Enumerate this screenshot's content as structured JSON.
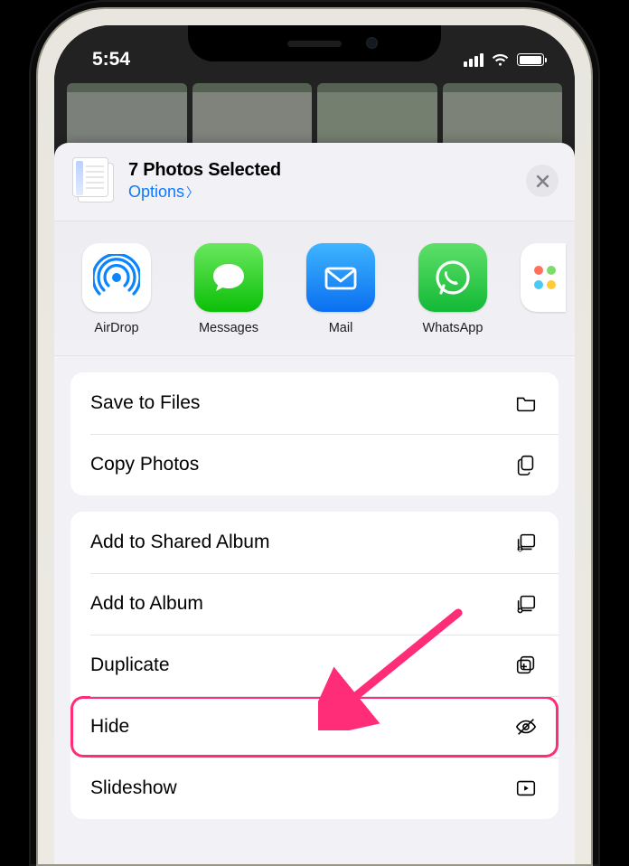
{
  "status": {
    "time": "5:54"
  },
  "sheet": {
    "header": {
      "title": "7 Photos Selected",
      "options_label": "Options"
    },
    "apps": [
      {
        "label": "AirDrop"
      },
      {
        "label": "Messages"
      },
      {
        "label": "Mail"
      },
      {
        "label": "WhatsApp"
      }
    ],
    "group1": [
      {
        "label": "Save to Files"
      },
      {
        "label": "Copy Photos"
      }
    ],
    "group2": [
      {
        "label": "Add to Shared Album"
      },
      {
        "label": "Add to Album"
      },
      {
        "label": "Duplicate"
      },
      {
        "label": "Hide"
      },
      {
        "label": "Slideshow"
      }
    ]
  },
  "annotation": {
    "arrow_color": "#ff2d78",
    "highlight_color": "#ff2d78"
  }
}
